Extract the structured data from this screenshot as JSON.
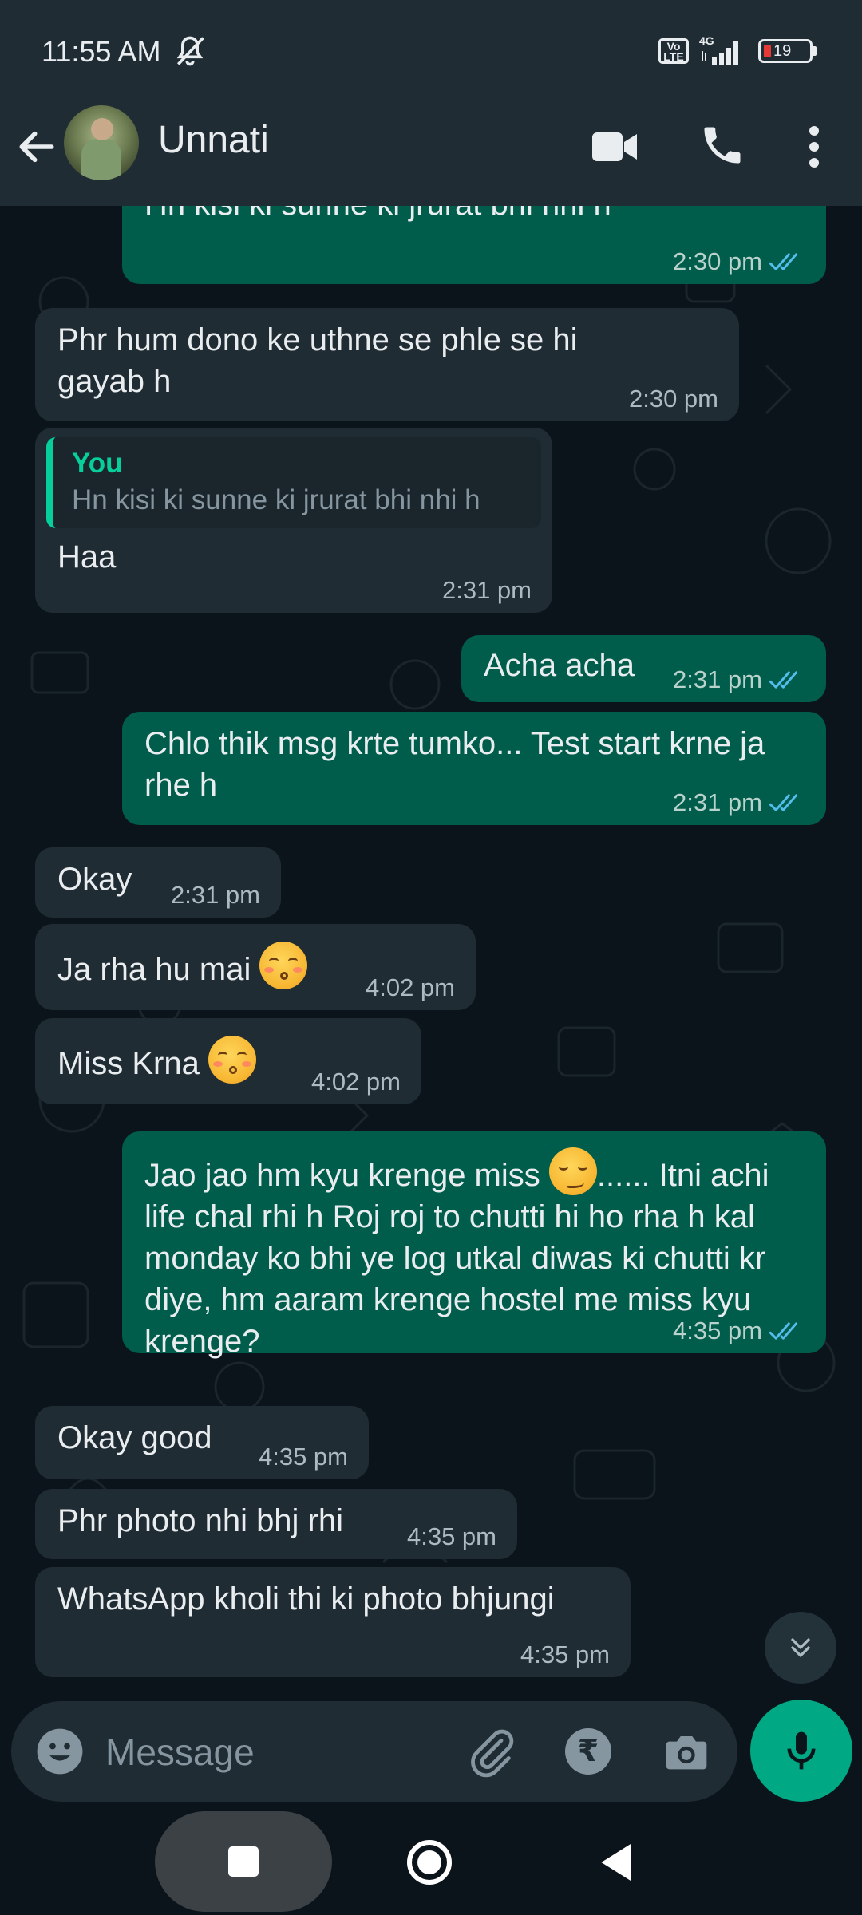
{
  "status_bar": {
    "time": "11:55 AM",
    "volte": "Vo LTE",
    "network": "4G",
    "battery": "19"
  },
  "header": {
    "contact_name": "Unnati"
  },
  "messages": [
    {
      "dir": "out",
      "text": "Hn kisi ki sunne ki jrurat bhi nhi h",
      "time": "2:30 pm"
    },
    {
      "dir": "in",
      "text": "Phr hum dono ke uthne se phle se hi gayab h",
      "time": "2:30 pm"
    },
    {
      "dir": "in",
      "quote_author": "You",
      "quote_text": "Hn kisi ki sunne ki jrurat bhi nhi h",
      "text": "Haa",
      "time": "2:31 pm"
    },
    {
      "dir": "out",
      "text": "Acha acha",
      "time": "2:31 pm"
    },
    {
      "dir": "out",
      "text": "Chlo thik msg krte tumko... Test start krne ja rhe h",
      "time": "2:31 pm"
    },
    {
      "dir": "in",
      "text": "Okay",
      "time": "2:31 pm"
    },
    {
      "dir": "in",
      "text": "Ja rha hu mai",
      "time": "4:02 pm"
    },
    {
      "dir": "in",
      "text": "Miss Krna",
      "time": "4:02 pm"
    },
    {
      "dir": "out",
      "text_part1": "Jao jao hm kyu krenge miss",
      "text_part2": "...... Itni achi life chal rhi h Roj roj to chutti hi ho rha h kal monday ko bhi ye log utkal diwas ki chutti kr diye, hm aaram krenge hostel me miss kyu krenge?",
      "time": "4:35 pm"
    },
    {
      "dir": "in",
      "text": "Okay good",
      "time": "4:35 pm"
    },
    {
      "dir": "in",
      "text": "Phr photo nhi bhj rhi",
      "time": "4:35 pm"
    },
    {
      "dir": "in",
      "text": "WhatsApp kholi thi ki photo bhjungi",
      "time": "4:35 pm"
    }
  ],
  "input": {
    "placeholder": "Message",
    "rupee_symbol": "₹"
  },
  "colors": {
    "incoming_bubble": "#202c33",
    "outgoing_bubble": "#005c4b",
    "accent": "#00a884",
    "read_ticks": "#53bdeb"
  }
}
